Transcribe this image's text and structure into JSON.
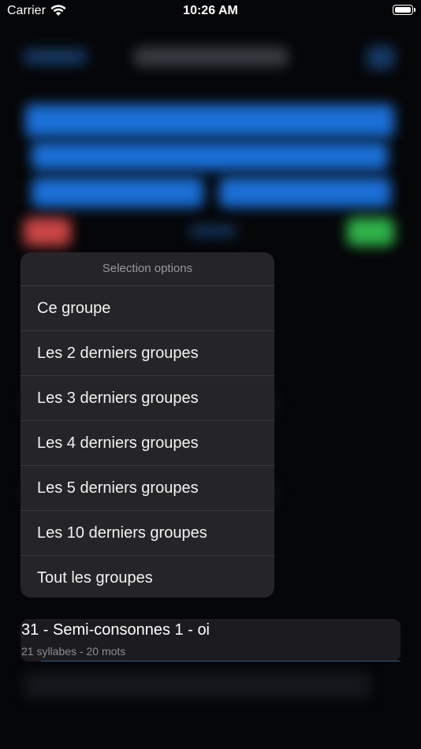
{
  "status_bar": {
    "carrier": "Carrier",
    "time": "10:26 AM"
  },
  "menu": {
    "header": "Selection options",
    "items": [
      "Ce groupe",
      "Les 2 derniers groupes",
      "Les 3 derniers groupes",
      "Les 4 derniers groupes",
      "Les 5 derniers groupes",
      "Les 10 derniers groupes",
      "Tout les groupes"
    ]
  },
  "current_group": {
    "title": "31 - Semi-consonnes 1 - oi",
    "subtitle": "21 syllabes - 20 mots"
  },
  "colors": {
    "accent": "#1b6fd6",
    "menu_bg": "#252528",
    "background": "#050608"
  }
}
